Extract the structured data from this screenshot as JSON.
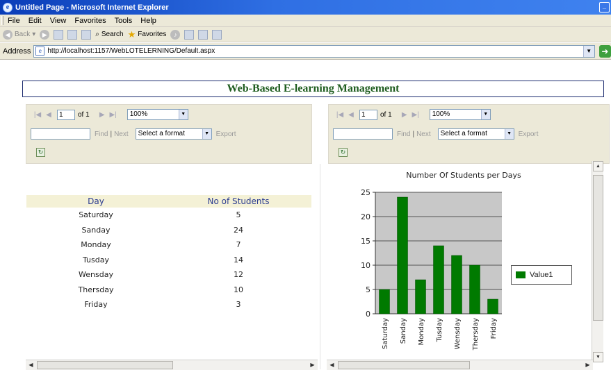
{
  "window": {
    "title": "Untitled Page - Microsoft Internet Explorer"
  },
  "menu": {
    "items": [
      "File",
      "Edit",
      "View",
      "Favorites",
      "Tools",
      "Help"
    ]
  },
  "toolbar": {
    "back": "Back",
    "search": "Search",
    "favorites": "Favorites"
  },
  "address": {
    "label": "Address",
    "url": "http://localhost:1157/WebLOTELERNING/Default.aspx"
  },
  "page": {
    "header": "Web-Based E-learning Management"
  },
  "report_viewer_left": {
    "page_number": "1",
    "of_text": "of 1",
    "zoom": "100%",
    "find": "Find",
    "separator": "|",
    "next": "Next",
    "format": "Select a format",
    "export": "Export"
  },
  "report_viewer_right": {
    "page_number": "1",
    "of_text": "of 1",
    "zoom": "100%",
    "find": "Find",
    "separator": "|",
    "next": "Next",
    "format": "Select a format",
    "export": "Export"
  },
  "table": {
    "headers": [
      "Day",
      "No of Students"
    ],
    "rows": [
      [
        "Saturday",
        "5"
      ],
      [
        "Sanday",
        "24"
      ],
      [
        "Monday",
        "7"
      ],
      [
        "Tusday",
        "14"
      ],
      [
        "Wensday",
        "12"
      ],
      [
        "Thersday",
        "10"
      ],
      [
        "Friday",
        "3"
      ]
    ]
  },
  "chart_data": {
    "type": "bar",
    "title": "Number Of Students per Days",
    "categories": [
      "Saturday",
      "Sanday",
      "Monday",
      "Tusday",
      "Wensday",
      "Thersday",
      "Friday"
    ],
    "series": [
      {
        "name": "Value1",
        "values": [
          5,
          24,
          7,
          14,
          12,
          10,
          3
        ]
      }
    ],
    "yticks": [
      0,
      5,
      10,
      15,
      20,
      25
    ],
    "ylim": [
      0,
      25
    ],
    "grid": true,
    "legend": "right",
    "plot_background": "#c8c8c8",
    "bar_color": "#007a00"
  }
}
